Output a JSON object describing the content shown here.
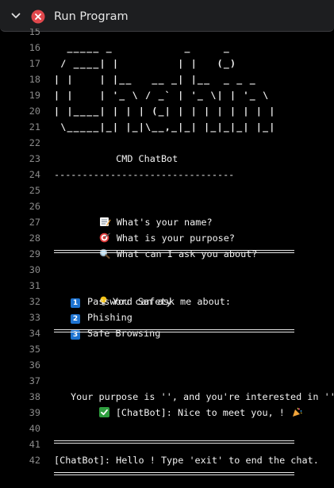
{
  "window": {
    "title": "Run Program"
  },
  "line_numbers": [
    "15",
    "16",
    "17",
    "18",
    "19",
    "20",
    "21",
    "22",
    "23",
    "24",
    "25",
    "26",
    "27",
    "28",
    "29",
    "30",
    "31",
    "32",
    "33",
    "34",
    "35",
    "36",
    "37",
    "38",
    "39",
    "40",
    "41",
    "42"
  ],
  "logo_lines": [
    "  _____ _           _     _   ",
    " / ____| |         | |   (_)  ",
    "| |    | |__   __ _| |__  _ _ _",
    "| |    | '_ \\ / _` | '_ \\| | '_ \\",
    "| |____| | | | (_| | | | | | | | |",
    " \\_____|_| |_|\\__,_|_| |_|_|_| |_|"
  ],
  "app_title": "           CMD ChatBot",
  "dash_line": "--------------------------------",
  "prompts": [
    {
      "icon": "memo-icon",
      "text": "What's your name?"
    },
    {
      "icon": "target-icon",
      "text": "What is your purpose?"
    },
    {
      "icon": "magnifier-icon",
      "text": "What can I ask you about?"
    }
  ],
  "topics_header": "You can ask me about:",
  "topics": [
    {
      "num": "1",
      "label": "Password Safety"
    },
    {
      "num": "2",
      "label": "Phishing"
    },
    {
      "num": "3",
      "label": "Safe Browsing"
    }
  ],
  "greeting": "[ChatBot]: Nice to meet you, ! ",
  "purpose_line": "Your purpose is '', and you're interested in ''.",
  "hello_line": "[ChatBot]: Hello ! Type 'exit' to end the chat.",
  "colors": {
    "background": "#000000",
    "titlebar": "#1d1e20",
    "error_red": "#e0474c",
    "keycap_blue": "#1d73d1",
    "check_green": "#2f9e3f"
  }
}
